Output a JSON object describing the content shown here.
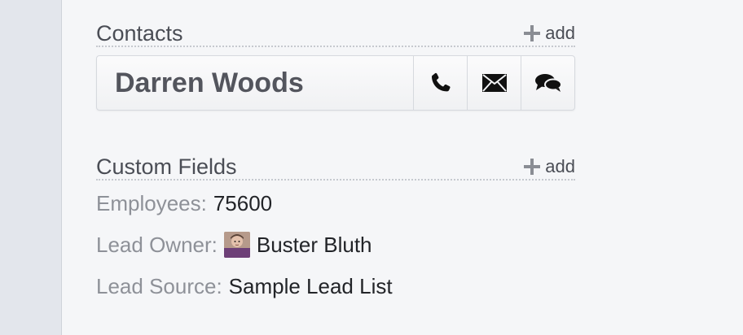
{
  "contacts": {
    "title": "Contacts",
    "add_label": "add",
    "items": [
      {
        "name": "Darren Woods",
        "actions": [
          {
            "icon": "phone-icon"
          },
          {
            "icon": "email-icon"
          },
          {
            "icon": "chat-icon"
          }
        ]
      }
    ]
  },
  "custom_fields": {
    "title": "Custom Fields",
    "add_label": "add",
    "fields": [
      {
        "label": "Employees:",
        "value": "75600"
      },
      {
        "label": "Lead Owner:",
        "value": "Buster Bluth",
        "avatar": "user-avatar"
      },
      {
        "label": "Lead Source:",
        "value": "Sample Lead List"
      }
    ]
  },
  "colors": {
    "background": "#f5f6f8",
    "sidebar": "#e3e6ec",
    "label": "#8e9198",
    "value": "#222428",
    "heading": "#4a4d55",
    "contact_name": "#53555d"
  }
}
